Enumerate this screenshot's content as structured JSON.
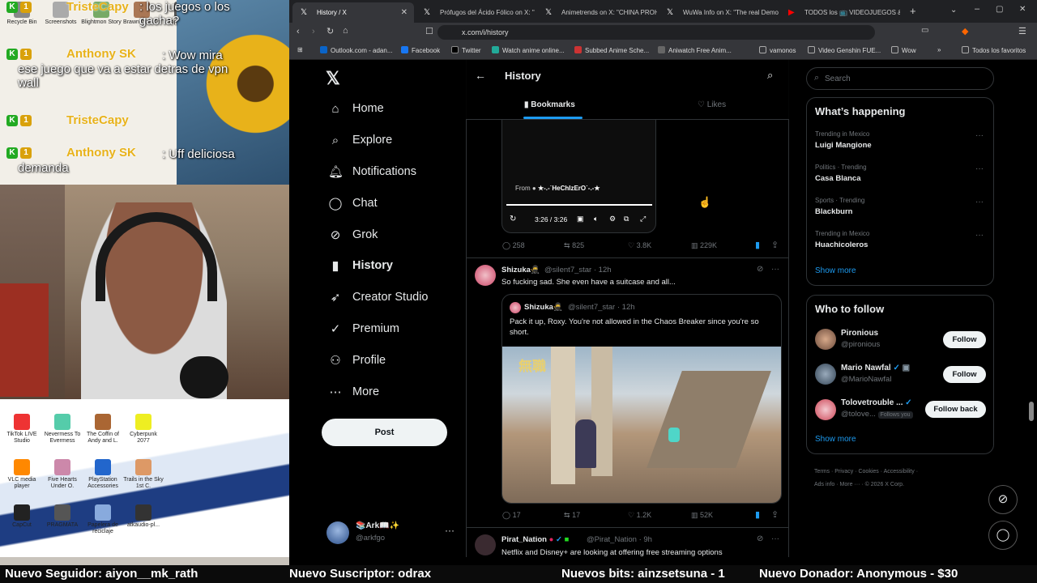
{
  "overlay": {
    "chat": [
      {
        "user": "TristeCapy",
        "badges": [
          "K",
          "1"
        ],
        "message": ": los juegos o los gacha?"
      },
      {
        "user": "Anthony SK",
        "badges": [
          "K",
          "1"
        ],
        "message": ": Wow mira ese juego que va a estar detras de vpn wall"
      },
      {
        "user": "TristeCapy",
        "badges": [
          "K",
          "1"
        ],
        "message": ""
      },
      {
        "user": "Anthony SK",
        "badges": [
          "K",
          "1"
        ],
        "message": ": Uff deliciosa demanda"
      }
    ],
    "desktop_icons_top": [
      "Recycle Bin",
      "Screenshots",
      "Blightmon Story",
      "Brawn Dust Gr",
      "Topping Url"
    ],
    "desktop_icons": [
      {
        "label": "TikTok LIVE Studio",
        "color": "#e33"
      },
      {
        "label": "Nevermess To Evermess",
        "color": "#5ca"
      },
      {
        "label": "The Coffin of Andy and L.",
        "color": "#a63"
      },
      {
        "label": "Cyberpunk 2077",
        "color": "#ee2"
      },
      {
        "label": "VLC media player",
        "color": "#f80"
      },
      {
        "label": "Five Hearts Under O.",
        "color": "#c8a"
      },
      {
        "label": "PlayStation Accessories",
        "color": "#26c"
      },
      {
        "label": "Trails in the Sky 1st C.",
        "color": "#d96"
      },
      {
        "label": "CapCut",
        "color": "#222"
      },
      {
        "label": "PRAGMATA",
        "color": "#555"
      },
      {
        "label": "Papelera de reciclaje",
        "color": "#8ad"
      },
      {
        "label": "atkaudio-pl...",
        "color": "#333"
      }
    ]
  },
  "browser": {
    "tabs": [
      {
        "title": "History / X",
        "active": true
      },
      {
        "title": "Prófugos del Ácido Fólico on X: \"",
        "active": false
      },
      {
        "title": "Animetrends on X: \"CHINA PROH",
        "active": false
      },
      {
        "title": "WuWa Info on X: \"The real Demo",
        "active": false
      },
      {
        "title": "TODOS los 📺 VIDEOJUEGOS &",
        "active": false
      }
    ],
    "url": "x.com/i/history",
    "bookmarks": [
      {
        "label": "Outlook.com - adan...",
        "color": "#0a64c8"
      },
      {
        "label": "Facebook",
        "color": "#1877f2"
      },
      {
        "label": "Twitter",
        "color": "#000"
      },
      {
        "label": "Watch anime online...",
        "color": "#2a9"
      },
      {
        "label": "Subbed Anime Sche...",
        "color": "#c33"
      },
      {
        "label": "Aniwatch Free Anim...",
        "color": "#666"
      },
      {
        "label": "vamonos",
        "color": "#aaa"
      },
      {
        "label": "Video Genshin FUE...",
        "color": "#aaa"
      },
      {
        "label": "Wow",
        "color": "#aaa"
      },
      {
        "label": "Todos los favoritos",
        "color": "#aaa"
      }
    ]
  },
  "nav": {
    "logo": "𝕏",
    "items": [
      {
        "label": "Home",
        "icon": "⌂",
        "bold": false
      },
      {
        "label": "Explore",
        "icon": "⌕",
        "bold": false
      },
      {
        "label": "Notifications",
        "icon": "🔔︎",
        "bold": false
      },
      {
        "label": "Chat",
        "icon": "◯",
        "bold": false
      },
      {
        "label": "Grok",
        "icon": "⊘",
        "bold": false
      },
      {
        "label": "History",
        "icon": "▮",
        "bold": true
      },
      {
        "label": "Creator Studio",
        "icon": "➶",
        "bold": false
      },
      {
        "label": "Premium",
        "icon": "✓",
        "bold": false
      },
      {
        "label": "Profile",
        "icon": "⚇",
        "bold": false
      },
      {
        "label": "More",
        "icon": "⋯",
        "bold": false
      }
    ],
    "post_label": "Post",
    "account": {
      "name": "📚Ark📖✨",
      "handle": "@arkfgo"
    }
  },
  "main": {
    "title": "History",
    "tabs": {
      "bookmarks": "Bookmarks",
      "likes": "Likes"
    },
    "tweet1": {
      "video_from": "From",
      "video_source": "★-.-˙HeChIzErO˙-.-★",
      "video_time": "3:26 / 3:26",
      "replies": "258",
      "reposts": "825",
      "likes": "3.8K",
      "views": "229K"
    },
    "tweet2": {
      "name": "Shizuka🥷",
      "handle": "@silent7_star",
      "time": "· 12h",
      "text": "So fucking sad. She even have a suitcase and all...",
      "quote": {
        "name": "Shizuka🥷",
        "handle": "@silent7_star",
        "time": "· 12h",
        "text": "Pack it up, Roxy. You're not allowed in the Chaos Breaker since you're so short."
      },
      "replies": "17",
      "reposts": "17",
      "likes": "1.2K",
      "views": "52K"
    },
    "tweet3": {
      "name": "Pirat_Nation",
      "handle": "@Pirat_Nation",
      "time": "· 9h",
      "text": "Netflix and Disney+ are looking at offering free streaming options"
    }
  },
  "sidebar": {
    "search_placeholder": "Search",
    "happening_title": "What’s happening",
    "trends": [
      {
        "context": "Trending in Mexico",
        "name": "Luigi Mangione"
      },
      {
        "context": "Politics · Trending",
        "name": "Casa Blanca"
      },
      {
        "context": "Sports · Trending",
        "name": "Blackburn"
      },
      {
        "context": "Trending in Mexico",
        "name": "Huachicoleros"
      }
    ],
    "show_more": "Show more",
    "wtf_title": "Who to follow",
    "who_to_follow": [
      {
        "name": "Pironious",
        "handle": "@pironious",
        "button": "Follow",
        "color": "#c98"
      },
      {
        "name": "Mario Nawfal",
        "handle": "@MarioNawfal",
        "button": "Follow",
        "color": "#567"
      },
      {
        "name": "Tolovetrouble ...",
        "handle": "@tolove...",
        "follows_you": "Follows you",
        "button": "Follow back",
        "color": "#c45"
      }
    ],
    "footer": [
      "Terms",
      "Privacy",
      "Cookies",
      "Accessibility",
      "Ads info",
      "More ···",
      "© 2026 X Corp."
    ]
  },
  "ticker": [
    "Nuevo Seguidor: aiyon__mk_rath",
    "Nuevo Suscriptor: odrax",
    "Nuevos bits: ainzsetsuna - 1",
    "Nuevo Donador: Anonymous - $30"
  ]
}
